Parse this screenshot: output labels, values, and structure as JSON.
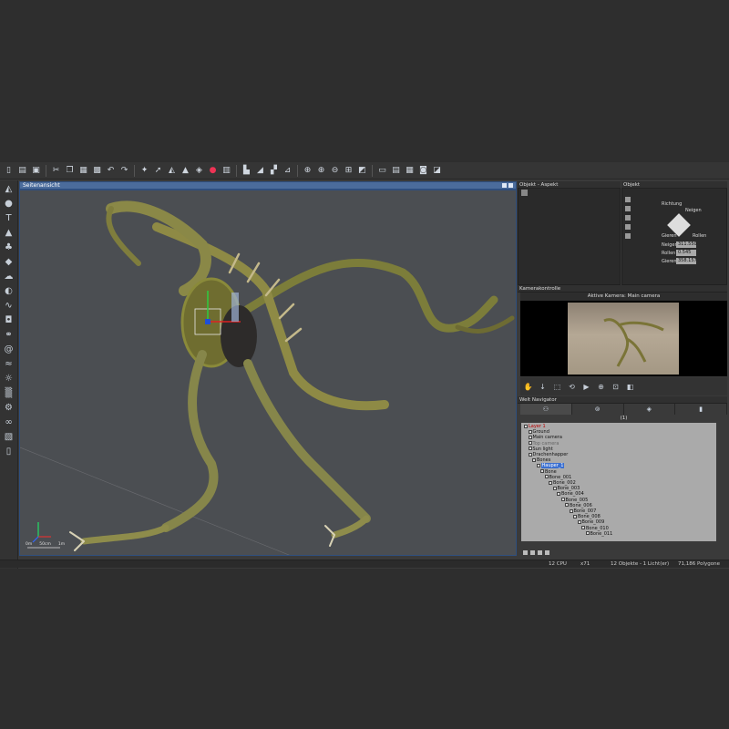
{
  "viewport": {
    "title": "Seitenansicht",
    "scale_labels": [
      "0m",
      "50cm",
      "1m"
    ]
  },
  "aspect_panel": {
    "title": "Objekt - Aspekt"
  },
  "object_panel": {
    "title": "Objekt",
    "gizmo_labels": {
      "direction": "Richtung",
      "roll": "Rollen",
      "yaw": "Gieren",
      "pitch": "Neigen"
    },
    "fields": [
      {
        "label": "Neigen",
        "value": "311.550"
      },
      {
        "label": "Rollen",
        "value": "0.545"
      },
      {
        "label": "Gieren",
        "value": "358.157"
      }
    ]
  },
  "camera_control": {
    "title": "Kamerakontrolle",
    "active_camera": "Aktive Kamera: Main camera"
  },
  "world_navigator": {
    "title": "Welt Navigator",
    "count_label": "(1)",
    "tree": [
      {
        "label": "Layer 1",
        "indent": 0,
        "style": "red"
      },
      {
        "label": "Ground",
        "indent": 1,
        "style": "normal"
      },
      {
        "label": "Main camera",
        "indent": 1,
        "style": "normal"
      },
      {
        "label": "Top camera",
        "indent": 1,
        "style": "grey"
      },
      {
        "label": "Sun light",
        "indent": 1,
        "style": "normal"
      },
      {
        "label": "Drachenhapper",
        "indent": 1,
        "style": "normal"
      },
      {
        "label": "Bones",
        "indent": 2,
        "style": "normal"
      },
      {
        "label": "Hauper_1",
        "indent": 3,
        "style": "sel"
      },
      {
        "label": "Bone",
        "indent": 4,
        "style": "normal"
      },
      {
        "label": "Bone_001",
        "indent": 5,
        "style": "normal"
      },
      {
        "label": "Bone_002",
        "indent": 6,
        "style": "normal"
      },
      {
        "label": "Bone_003",
        "indent": 7,
        "style": "normal"
      },
      {
        "label": "Bone_004",
        "indent": 8,
        "style": "normal"
      },
      {
        "label": "Bone_005",
        "indent": 9,
        "style": "normal"
      },
      {
        "label": "Bone_006",
        "indent": 10,
        "style": "normal"
      },
      {
        "label": "Bone_007",
        "indent": 11,
        "style": "normal"
      },
      {
        "label": "Bone_008",
        "indent": 12,
        "style": "normal"
      },
      {
        "label": "Bone_009",
        "indent": 13,
        "style": "normal"
      },
      {
        "label": "Bone_010",
        "indent": 14,
        "style": "normal"
      },
      {
        "label": "Bone_011",
        "indent": 15,
        "style": "normal"
      }
    ]
  },
  "status": {
    "cpu": "12 CPU",
    "zoom": "x71",
    "objects": "12 Objekte - 1 Licht(er)",
    "polygons": "71,186 Polygone"
  },
  "colors": {
    "selection": "#3a6fd0",
    "viewport_bg": "#4b4e52",
    "viewport_header": "#4b6c9c",
    "dragon": "#8a8a3a"
  }
}
